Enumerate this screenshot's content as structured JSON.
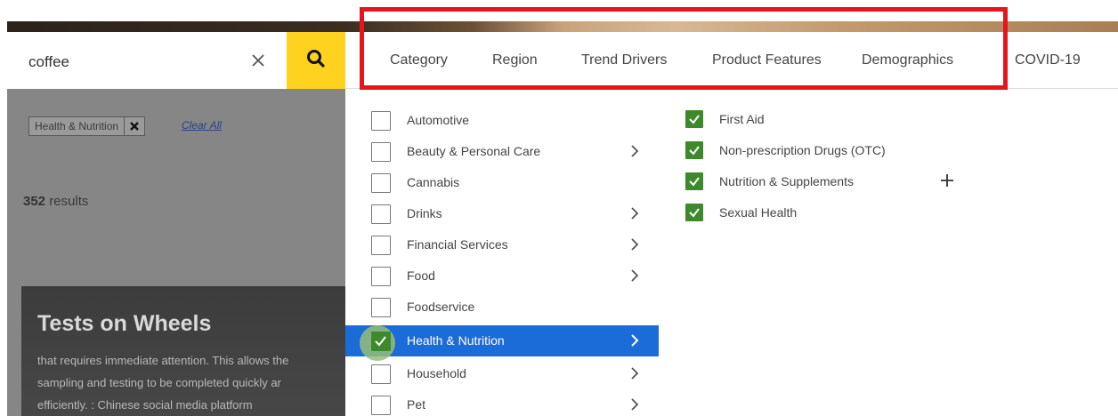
{
  "search": {
    "value": "coffee"
  },
  "filters": {
    "chip_label": "Health & Nutrition",
    "clear_all": "Clear All"
  },
  "results": {
    "count": "352",
    "count_suffix": "results"
  },
  "card": {
    "title": "Tests on Wheels",
    "lines": [
      "that requires immediate attention. This allows the",
      "sampling and testing to be completed quickly ar",
      "efficiently. : Chinese social media platform"
    ]
  },
  "nav": {
    "tabs": [
      "Category",
      "Region",
      "Trend Drivers",
      "Product Features",
      "Demographics",
      "COVID-19"
    ]
  },
  "categories": [
    {
      "label": "Automotive",
      "checked": false,
      "has_children": false
    },
    {
      "label": "Beauty & Personal Care",
      "checked": false,
      "has_children": true
    },
    {
      "label": "Cannabis",
      "checked": false,
      "has_children": false
    },
    {
      "label": "Drinks",
      "checked": false,
      "has_children": true
    },
    {
      "label": "Financial Services",
      "checked": false,
      "has_children": true
    },
    {
      "label": "Food",
      "checked": false,
      "has_children": true
    },
    {
      "label": "Foodservice",
      "checked": false,
      "has_children": false
    },
    {
      "label": "Health & Nutrition",
      "checked": true,
      "has_children": true,
      "selected": true
    },
    {
      "label": "Household",
      "checked": false,
      "has_children": true
    },
    {
      "label": "Pet",
      "checked": false,
      "has_children": true
    }
  ],
  "subcategories": [
    {
      "label": "First Aid",
      "checked": true
    },
    {
      "label": "Non-prescription Drugs (OTC)",
      "checked": true
    },
    {
      "label": "Nutrition & Supplements",
      "checked": true
    },
    {
      "label": "Sexual Health",
      "checked": true
    }
  ],
  "colors": {
    "accent_yellow": "#ffd21f",
    "selected_blue": "#1b6bd8",
    "check_green": "#3e8a2a",
    "highlight_red": "#e8141b"
  },
  "icons": {
    "clear": "close-icon",
    "search": "search-icon",
    "chevron": "chevron-right-icon",
    "add": "plus-icon",
    "check": "check-icon"
  }
}
